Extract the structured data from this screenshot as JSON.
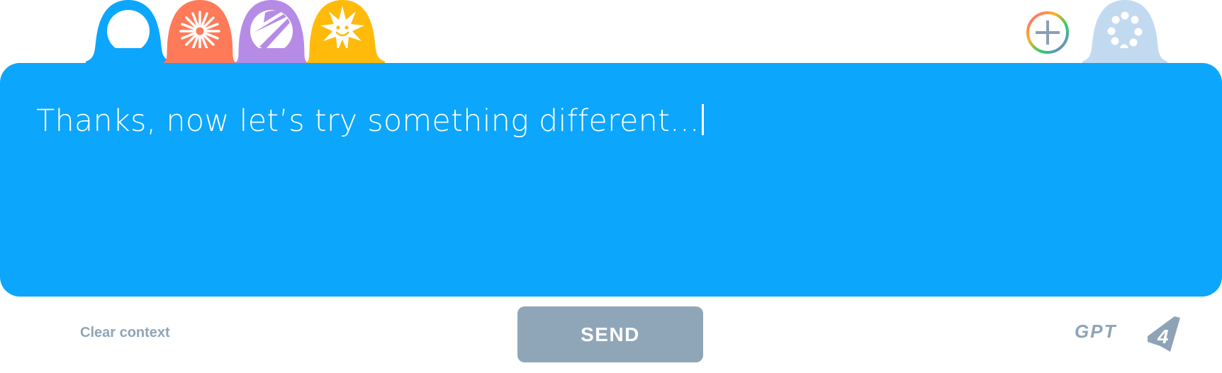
{
  "palette": {
    "panel": "#0ca6fc",
    "tab_blue": "#0ca6fc",
    "tab_coral": "#ff7a59",
    "tab_purple": "#b68be6",
    "tab_yellow": "#ffba0a",
    "tab_light": "#c2daf0",
    "muted": "#8fa6b9"
  },
  "tabs": [
    {
      "icon": "circle-icon",
      "color": "#0ca6fc",
      "selected": true
    },
    {
      "icon": "sunburst-icon",
      "color": "#ff7a59",
      "selected": false
    },
    {
      "icon": "slash-globe-icon",
      "color": "#b68be6",
      "selected": false
    },
    {
      "icon": "smiling-sun-icon",
      "color": "#ffba0a",
      "selected": false
    }
  ],
  "settings_tab": {
    "icon": "dotted-ring-icon",
    "color": "#c2daf0"
  },
  "add_button": {
    "icon": "plus-icon"
  },
  "prompt": {
    "text": "Thanks, now let’s try something different..."
  },
  "actions": {
    "clear_label": "Clear context",
    "send_label": "SEND"
  },
  "model_badge": {
    "text": "GPT",
    "number": "4"
  }
}
